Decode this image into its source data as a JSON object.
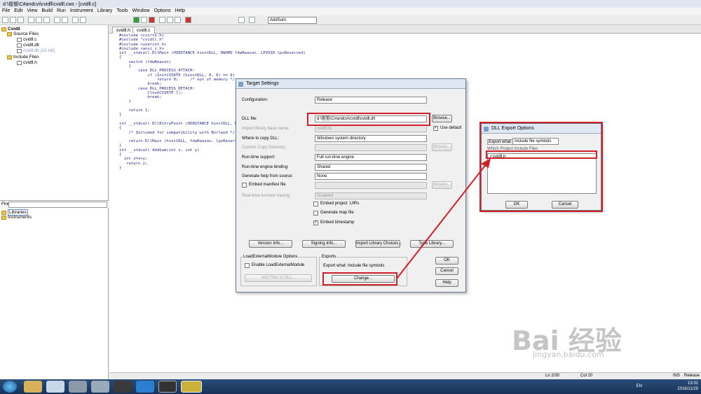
{
  "window": {
    "title": "d:\\祖祖\\C#andcvi\\cvidll\\cvidll.cws - [cvidll.c]"
  },
  "menu": [
    "File",
    "Edit",
    "View",
    "Build",
    "Run",
    "Instrument",
    "Library",
    "Tools",
    "Window",
    "Options",
    "Help"
  ],
  "toolbar": {
    "combo_value": "AddSum"
  },
  "project_tree": {
    "root": "Cvidll",
    "source_files": "Source Files",
    "files": [
      "cvidll.c",
      "cvidll.dll",
      "cvidll.lib (32-bit)"
    ],
    "include_files": "Include Files",
    "headers": [
      "cvidll.h"
    ]
  },
  "find": {
    "label": "Find"
  },
  "library_tree": {
    "libraries": "Libraries",
    "instruments": "Instruments"
  },
  "editor": {
    "tabs": [
      "cvidll.h",
      "cvidll.c"
    ],
    "code": "#include <cvirte.h>\n#include \"cvidll.h\"\n#include <userint.h>\n#include <ansi_c.h>\nint __stdcall DllMain (HINSTANCE hinstDLL, DWORD fdwReason, LPVOID lpvReserved)\n{\n    switch (fdwReason)\n    {\n        case DLL_PROCESS_ATTACH:\n            if (InitCVIRTE (hinstDLL, 0, 0) == 0)\n                return 0;     /* out of memory */\n            break;\n        case DLL_PROCESS_DETACH:\n            CloseCVIRTE ();\n            break;\n    }\n\n    return 1;\n}\n\nint __stdcall DllEntryPoint (HINSTANCE hinstDLL, DWORD\n{\n    /* Included for compatibility with Borland */\n\n    return DllMain (hinstDLL, fdwReason, lpvReserved)\n}\nint __stdcall AddSum(int x, int y)\n{\n  int z=x+y;\n   return z;\n}"
  },
  "target_settings": {
    "title": "Target Settings",
    "configuration_label": "Configuration:",
    "configuration_value": "Release",
    "dll_file_label": "DLL file:",
    "dll_file_value": "d:\\祖祖\\C#andcvi\\cvidll\\cvidll.dll",
    "browse": "Browse...",
    "use_default": "Use default",
    "import_lib_label": "Import library base name:",
    "import_lib_value": "cvidll.lib",
    "where_copy_label": "Where to copy DLL:",
    "where_copy_value": "Windows system directory",
    "custom_copy_label": "Custom Copy Directory:",
    "runtime_support_label": "Run-time support:",
    "runtime_support_value": "Full run-time engine",
    "runtime_binding_label": "Run-time engine binding:",
    "runtime_binding_value": "Shared",
    "generate_help_label": "Generate help from source:",
    "generate_help_value": "None",
    "embed_manifest_label": "Embed manifest file",
    "realtime_label": "Real-time function tracing:",
    "realtime_value": "Disabled",
    "embed_project_uirs": "Embed project .UIRs",
    "generate_map": "Generate map file",
    "embed_timestamp": "Embed timestamp",
    "version_info": "Version Info...",
    "signing_info": "Signing Info...",
    "import_library_choices": "Import Library Choices...",
    "type_library": "Type Library...",
    "load_group_label": "LoadExternalModule Options",
    "enable_load": "Enable LoadExternalModule",
    "add_files": "Add Files to DLL...",
    "exports_group_label": "Exports",
    "export_what": "Export what:  Include file symbols",
    "change": "Change...",
    "ok": "OK",
    "cancel": "Cancel",
    "help": "Help"
  },
  "dll_export": {
    "title": "DLL Export Options",
    "export_what_label": "Export what:",
    "export_what_value": "Include file symbols",
    "which_label": "Which Project Include Files",
    "item": "cvidll.h",
    "ok": "OK",
    "cancel": "Cancel"
  },
  "status": {
    "line": "Ln 2/30",
    "col": "Col 20",
    "ins": "INS",
    "mode": "Release"
  },
  "tray": {
    "lang": "EN",
    "time": "13:31",
    "date": "2016/11/29"
  },
  "watermark": {
    "brand": "Bai 经验",
    "url": "jingyan.baidu.com"
  },
  "colors": {
    "highlight": "#d0202a",
    "taskbar": "#1e3f66"
  }
}
